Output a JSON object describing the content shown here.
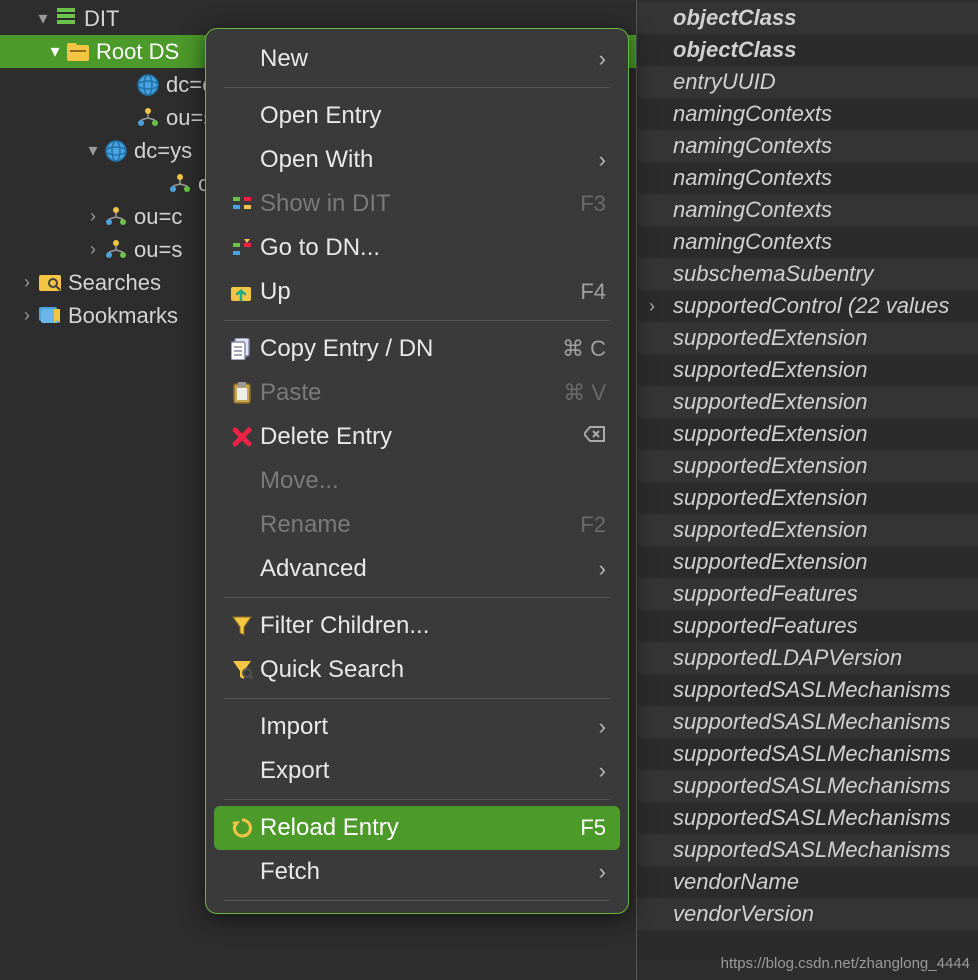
{
  "tree": {
    "items": [
      {
        "indent": 32,
        "expand": "▾",
        "icon": "dit-icon",
        "label": "DIT"
      },
      {
        "indent": 44,
        "expand": "▾",
        "icon": "folder-root-icon",
        "label": "Root DS",
        "selected": true
      },
      {
        "indent": 114,
        "expand": "",
        "icon": "globe-icon",
        "label": "dc=e"
      },
      {
        "indent": 114,
        "expand": "",
        "icon": "org-unit-icon",
        "label": "ou=s"
      },
      {
        "indent": 82,
        "expand": "▾",
        "icon": "globe-icon",
        "label": "dc=ys"
      },
      {
        "indent": 146,
        "expand": "",
        "icon": "org-unit-icon",
        "label": "ou"
      },
      {
        "indent": 82,
        "expand": "›",
        "icon": "org-unit-icon",
        "label": "ou=c"
      },
      {
        "indent": 82,
        "expand": "›",
        "icon": "org-unit-icon",
        "label": "ou=s"
      },
      {
        "indent": 16,
        "expand": "›",
        "icon": "searches-icon",
        "label": "Searches"
      },
      {
        "indent": 16,
        "expand": "›",
        "icon": "bookmarks-icon",
        "label": "Bookmarks"
      }
    ]
  },
  "attributes": [
    {
      "label": "objectClass",
      "bold": true
    },
    {
      "label": "objectClass",
      "bold": true
    },
    {
      "label": "entryUUID"
    },
    {
      "label": "namingContexts"
    },
    {
      "label": "namingContexts"
    },
    {
      "label": "namingContexts"
    },
    {
      "label": "namingContexts"
    },
    {
      "label": "namingContexts"
    },
    {
      "label": "subschemaSubentry"
    },
    {
      "label": "supportedControl (22 values",
      "expandable": true
    },
    {
      "label": "supportedExtension"
    },
    {
      "label": "supportedExtension"
    },
    {
      "label": "supportedExtension"
    },
    {
      "label": "supportedExtension"
    },
    {
      "label": "supportedExtension"
    },
    {
      "label": "supportedExtension"
    },
    {
      "label": "supportedExtension"
    },
    {
      "label": "supportedExtension"
    },
    {
      "label": "supportedFeatures"
    },
    {
      "label": "supportedFeatures"
    },
    {
      "label": "supportedLDAPVersion"
    },
    {
      "label": "supportedSASLMechanisms"
    },
    {
      "label": "supportedSASLMechanisms"
    },
    {
      "label": "supportedSASLMechanisms"
    },
    {
      "label": "supportedSASLMechanisms"
    },
    {
      "label": "supportedSASLMechanisms"
    },
    {
      "label": "supportedSASLMechanisms"
    },
    {
      "label": "vendorName"
    },
    {
      "label": "vendorVersion"
    },
    {
      "label": ""
    }
  ],
  "menu": {
    "items": [
      {
        "type": "item",
        "label": "New",
        "submenu": true
      },
      {
        "type": "sep"
      },
      {
        "type": "item",
        "label": "Open Entry"
      },
      {
        "type": "item",
        "label": "Open With",
        "submenu": true
      },
      {
        "type": "item",
        "label": "Show in DIT",
        "icon": "show-in-dit-icon",
        "shortcut": "F3",
        "disabled": true
      },
      {
        "type": "item",
        "label": "Go to DN...",
        "icon": "go-to-dn-icon"
      },
      {
        "type": "item",
        "label": "Up",
        "icon": "up-icon",
        "shortcut": "F4"
      },
      {
        "type": "sep"
      },
      {
        "type": "item",
        "label": "Copy Entry / DN",
        "icon": "copy-icon",
        "shortcut": "⌘ C"
      },
      {
        "type": "item",
        "label": "Paste",
        "icon": "paste-icon",
        "shortcut": "⌘ V",
        "disabled": true
      },
      {
        "type": "item",
        "label": "Delete Entry",
        "icon": "delete-icon",
        "shortcut": "⌫"
      },
      {
        "type": "item",
        "label": "Move...",
        "disabled": true
      },
      {
        "type": "item",
        "label": "Rename",
        "shortcut": "F2",
        "disabled": true
      },
      {
        "type": "item",
        "label": "Advanced",
        "submenu": true
      },
      {
        "type": "sep"
      },
      {
        "type": "item",
        "label": "Filter Children...",
        "icon": "filter-icon"
      },
      {
        "type": "item",
        "label": "Quick Search",
        "icon": "quick-search-icon"
      },
      {
        "type": "sep"
      },
      {
        "type": "item",
        "label": "Import",
        "submenu": true
      },
      {
        "type": "item",
        "label": "Export",
        "submenu": true
      },
      {
        "type": "sep"
      },
      {
        "type": "item",
        "label": "Reload Entry",
        "icon": "reload-icon",
        "shortcut": "F5",
        "highlighted": true
      },
      {
        "type": "item",
        "label": "Fetch",
        "submenu": true
      },
      {
        "type": "sep"
      }
    ]
  },
  "watermark": "https://blog.csdn.net/zhanglong_4444"
}
